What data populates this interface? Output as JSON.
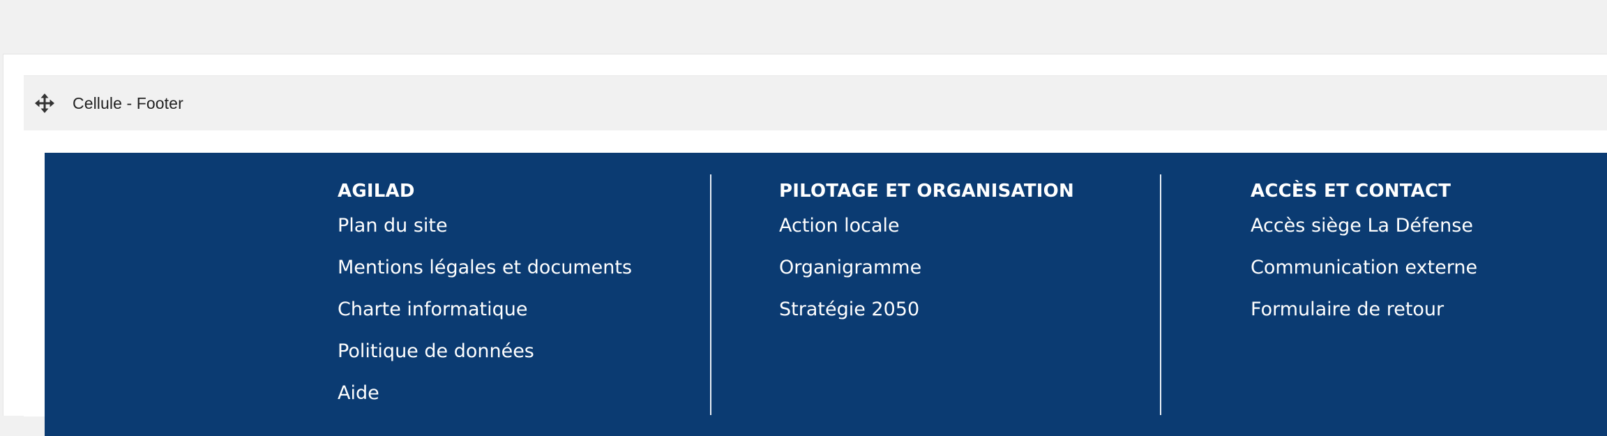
{
  "cell": {
    "title": "Cellule - Footer"
  },
  "footer": {
    "columns": [
      {
        "heading": "AGILAD",
        "links": [
          "Plan du site",
          "Mentions légales et documents",
          "Charte informatique",
          "Politique de données",
          "Aide"
        ]
      },
      {
        "heading": "PILOTAGE ET ORGANISATION",
        "links": [
          "Action locale",
          "Organigramme",
          "Stratégie 2050"
        ]
      },
      {
        "heading": "ACCÈS ET CONTACT",
        "links": [
          "Accès siège La Défense",
          "Communication externe",
          "Formulaire de retour"
        ]
      }
    ]
  },
  "colors": {
    "footer_background": "#0b3b72",
    "page_background": "#f1f1f1",
    "text_on_footer": "#ffffff"
  },
  "icons": {
    "move_handle": "move-arrows-icon"
  }
}
